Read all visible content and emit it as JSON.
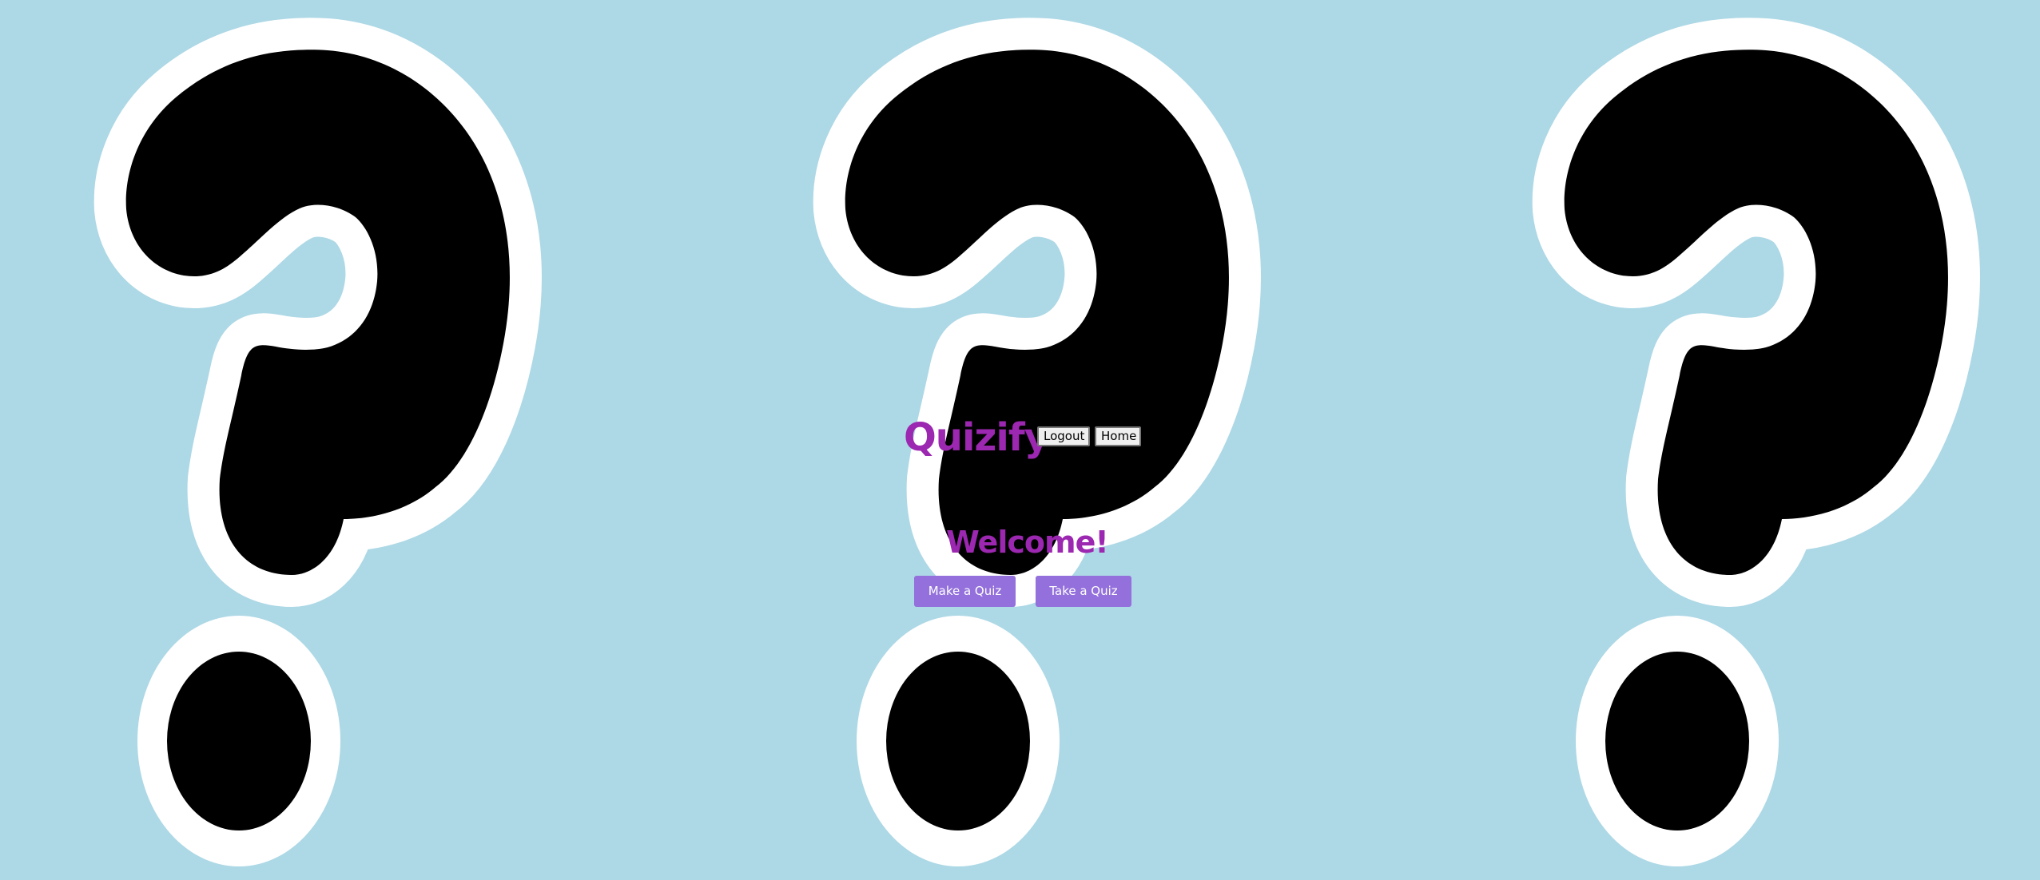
{
  "app": {
    "title": "Quizify"
  },
  "nav": {
    "logout_label": "Logout",
    "home_label": "Home"
  },
  "main": {
    "welcome": "Welcome!",
    "make_quiz_label": "Make a Quiz",
    "take_quiz_label": "Take a Quiz"
  },
  "background": {
    "icon": "question-mark-icon",
    "icon_count": 3
  },
  "colors": {
    "page_background": "#add8e6",
    "title": "#9c27b0",
    "button_background": "#9370db",
    "button_text": "#ffffff",
    "icon_fill": "#000000",
    "icon_outline": "#ffffff"
  }
}
